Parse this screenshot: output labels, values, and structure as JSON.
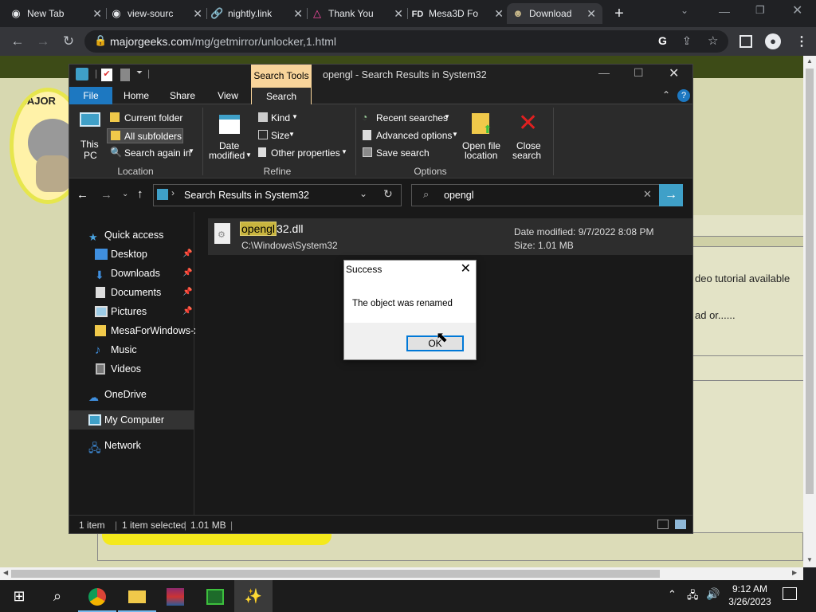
{
  "browser": {
    "tabs": [
      {
        "title": "New Tab",
        "icon": "chrome-icon"
      },
      {
        "title": "view-sourc",
        "icon": "chrome-icon"
      },
      {
        "title": "nightly.link",
        "icon": "link-icon"
      },
      {
        "title": "Thank You",
        "icon": "delta-icon"
      },
      {
        "title": "Mesa3D Fo",
        "icon": "fd-icon",
        "icon_text": "FD"
      },
      {
        "title": "Download",
        "icon": "majorgeeks-icon"
      }
    ],
    "url_host": "majorgeeks.com",
    "url_path": "/mg/getmirror/unlocker,1.html"
  },
  "webpage": {
    "logo_text": "MAJOR",
    "text_1": "deo tutorial available",
    "text_2": "ad or......"
  },
  "explorer": {
    "contextual_tab": "Search Tools",
    "title": "opengl - Search Results in System32",
    "ribbon_tabs": [
      "File",
      "Home",
      "Share",
      "View",
      "Search"
    ],
    "location": {
      "this_pc": [
        "This",
        "PC"
      ],
      "current_folder": "Current folder",
      "all_subfolders": "All subfolders",
      "search_again": "Search again in",
      "group_label": "Location"
    },
    "refine": {
      "date_modified": [
        "Date",
        "modified"
      ],
      "kind": "Kind",
      "size": "Size",
      "other_properties": "Other properties",
      "group_label": "Refine"
    },
    "options": {
      "recent_searches": "Recent searches",
      "advanced_options": "Advanced options",
      "save_search": "Save search",
      "open_file_location": [
        "Open file",
        "location"
      ],
      "close_search": [
        "Close",
        "search"
      ],
      "group_label": "Options"
    },
    "path": "Search Results in System32",
    "search_query": "opengl",
    "nav_pane": [
      {
        "label": "Quick access",
        "icon": "star-icon",
        "pinned": false
      },
      {
        "label": "Desktop",
        "icon": "desktop-icon",
        "pinned": true
      },
      {
        "label": "Downloads",
        "icon": "download-icon",
        "pinned": true
      },
      {
        "label": "Documents",
        "icon": "documents-icon",
        "pinned": true
      },
      {
        "label": "Pictures",
        "icon": "pictures-icon",
        "pinned": true
      },
      {
        "label": "MesaForWindows-x",
        "icon": "folder-icon",
        "pinned": false
      },
      {
        "label": "Music",
        "icon": "music-icon",
        "pinned": false
      },
      {
        "label": "Videos",
        "icon": "videos-icon",
        "pinned": false
      },
      {
        "label": "OneDrive",
        "icon": "cloud-icon",
        "pinned": false
      },
      {
        "label": "My Computer",
        "icon": "computer-icon",
        "pinned": false
      },
      {
        "label": "Network",
        "icon": "network-icon",
        "pinned": false
      }
    ],
    "result": {
      "name_highlight": "opengl",
      "name_rest": "32.dll",
      "path": "C:\\Windows\\System32",
      "date_modified": "Date modified: 9/7/2022 8:08 PM",
      "size": "Size: 1.01 MB"
    },
    "status": {
      "items": "1 item",
      "selected": "1 item selected",
      "selected_size": "1.01 MB"
    }
  },
  "dialog": {
    "title": "Success",
    "message": "The object was renamed",
    "ok_label": "OK"
  },
  "taskbar": {
    "time": "9:12 AM",
    "date": "3/26/2023"
  },
  "colors": {
    "accent_blue": "#3fa0c8",
    "highlight": "#c9b53f",
    "web_bg": "#d7d8b0"
  }
}
